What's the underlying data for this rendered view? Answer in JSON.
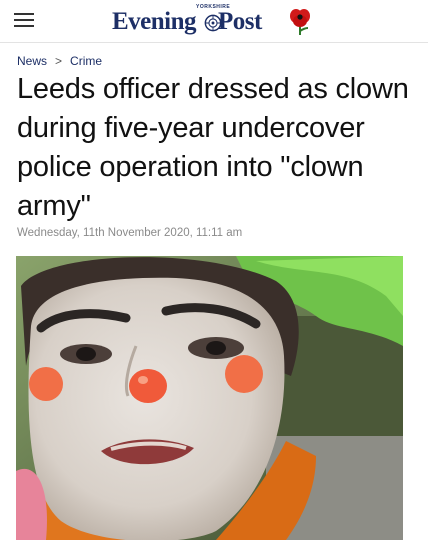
{
  "header": {
    "menu_icon": "hamburger-menu-icon",
    "logo_kicker": "YORKSHIRE",
    "logo_text_left": "Evening",
    "logo_text_right": "Post",
    "poppy_icon": "poppy-icon"
  },
  "breadcrumb": {
    "items": [
      "News",
      "Crime"
    ],
    "separator": ">"
  },
  "article": {
    "headline": "Leeds officer dressed as clown during five-year undercover police operation into \"clown army\"",
    "dateline": "Wednesday, 11th November 2020, 11:11 am"
  },
  "colors": {
    "brand": "#1d2f66",
    "poppy": "#d11a1a"
  }
}
